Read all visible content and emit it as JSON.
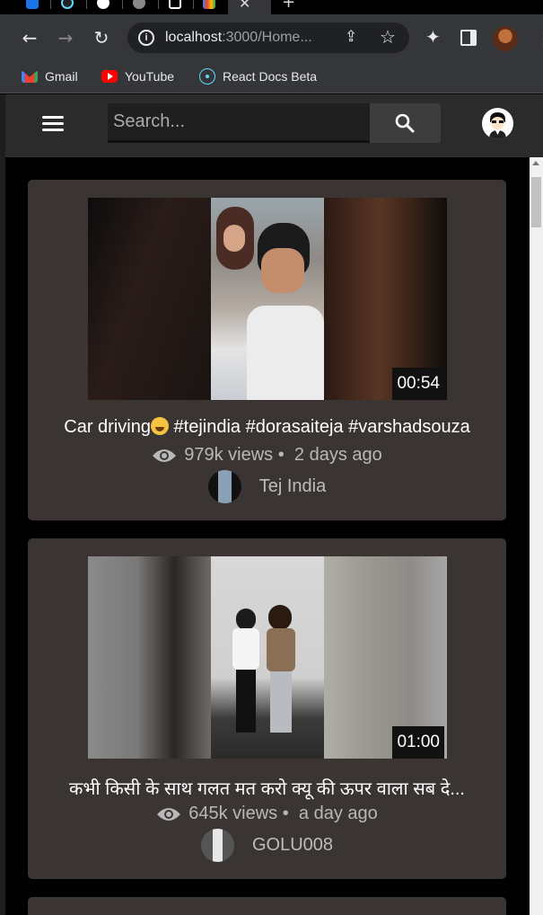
{
  "browser": {
    "address": {
      "host": "localhost",
      "path": ":3000/Home..."
    },
    "bookmarks": [
      {
        "label": "Gmail",
        "icon": "gmail-icon"
      },
      {
        "label": "YouTube",
        "icon": "youtube-icon"
      },
      {
        "label": "React Docs Beta",
        "icon": "react-icon"
      }
    ]
  },
  "header": {
    "search_placeholder": "Search...",
    "icons": [
      "menu-icon",
      "search-icon",
      "user-avatar"
    ]
  },
  "videos": [
    {
      "title_text": "Car driving",
      "title_tags": " #tejindia #dorasaiteja #varshadsouza",
      "duration": "00:54",
      "views": "979k views",
      "separator": "•",
      "age": "2 days ago",
      "channel": "Tej India"
    },
    {
      "title_text": "कभी किसी के साथ गलत मत करो क्यू की ऊपर वाला सब दे...",
      "title_tags": "",
      "duration": "01:00",
      "views": "645k views",
      "separator": "•",
      "age": "a day ago",
      "channel": "GOLU008"
    }
  ],
  "colors": {
    "page_bg": "#000000",
    "card_bg": "#3a3533",
    "header_bg": "#2b2b2b",
    "browser_chrome": "#35363a"
  }
}
